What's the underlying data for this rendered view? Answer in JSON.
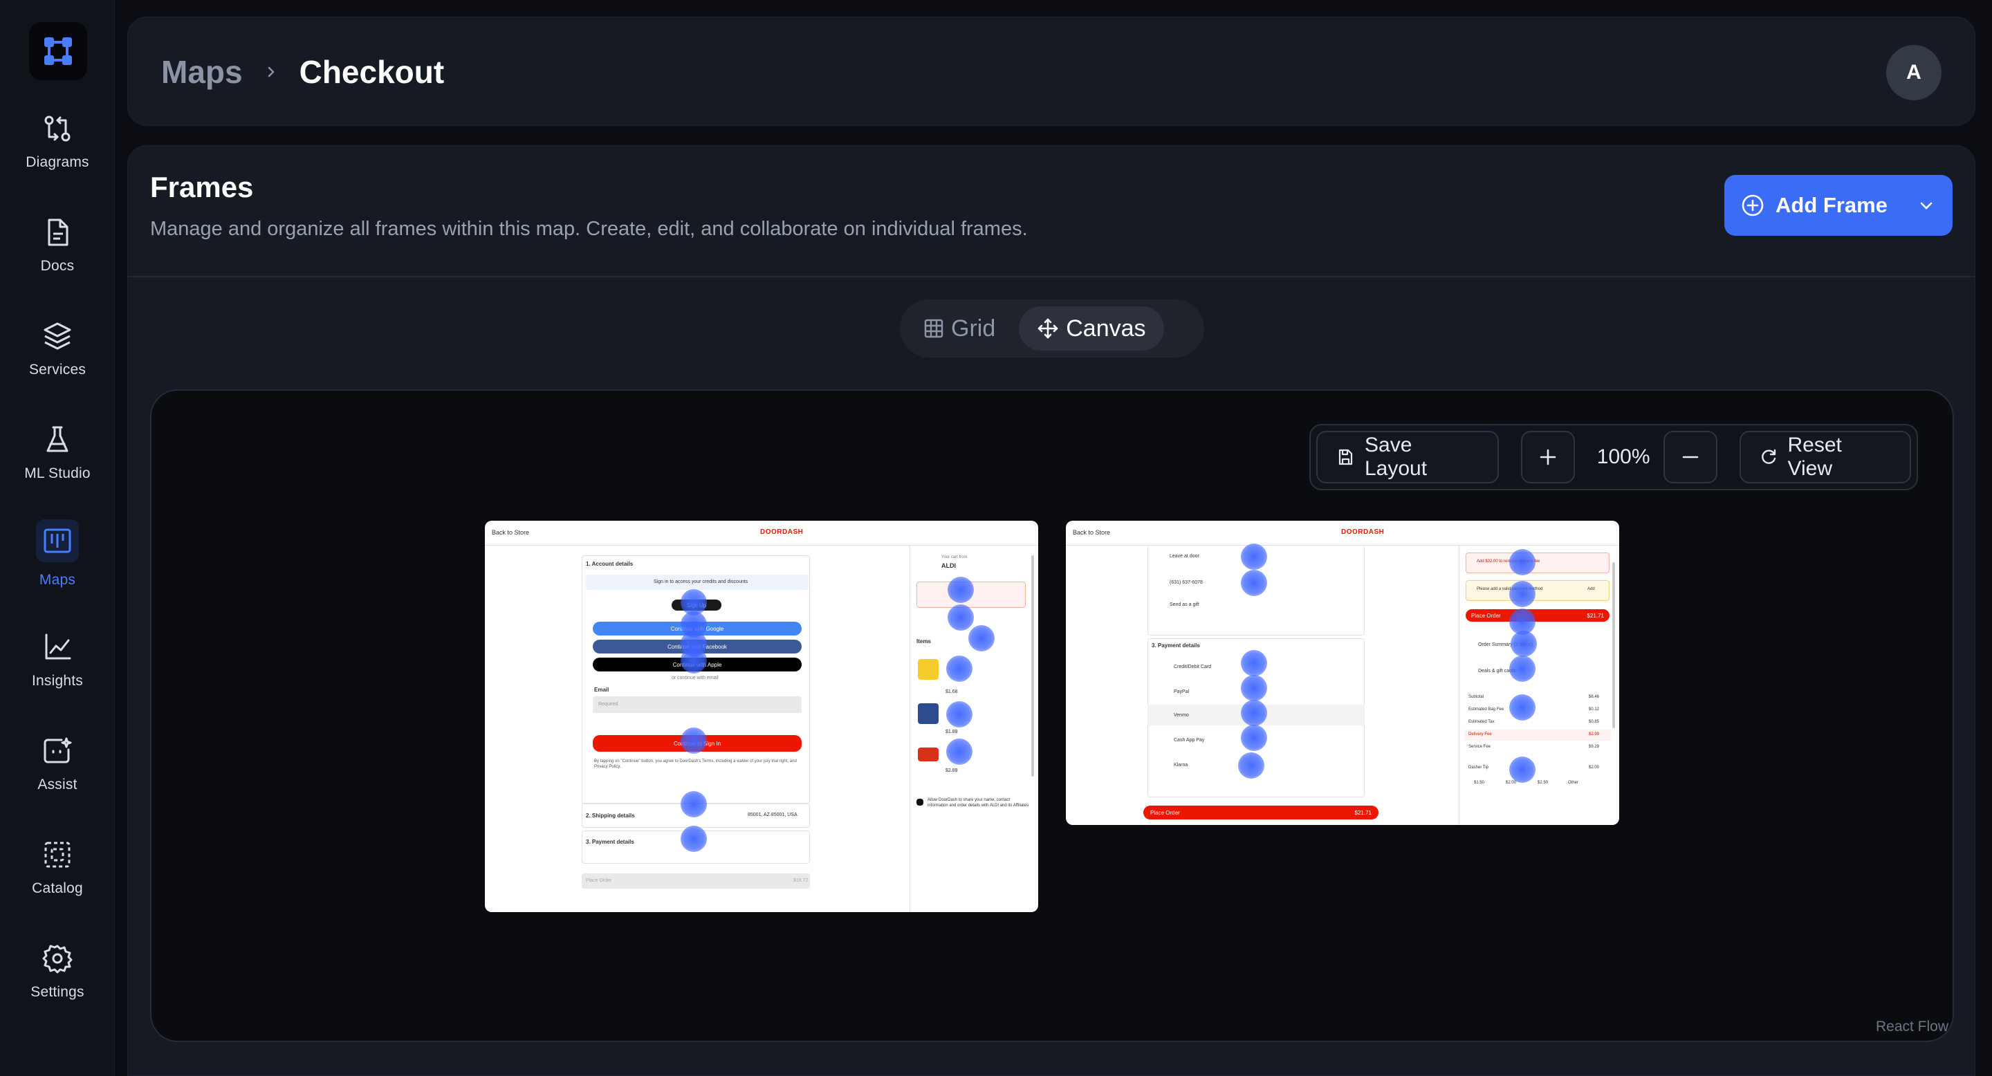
{
  "sidebar": {
    "items": [
      {
        "label": "Diagrams",
        "icon": "diagram-icon"
      },
      {
        "label": "Docs",
        "icon": "doc-icon"
      },
      {
        "label": "Services",
        "icon": "layers-icon"
      },
      {
        "label": "ML Studio",
        "icon": "flask-icon"
      },
      {
        "label": "Maps",
        "icon": "map-icon",
        "active": true
      },
      {
        "label": "Insights",
        "icon": "chart-line-icon"
      },
      {
        "label": "Assist",
        "icon": "assist-icon"
      },
      {
        "label": "Catalog",
        "icon": "catalog-icon"
      },
      {
        "label": "Settings",
        "icon": "gear-icon"
      }
    ]
  },
  "header": {
    "breadcrumb_parent": "Maps",
    "breadcrumb_current": "Checkout",
    "avatar_initial": "A"
  },
  "frames": {
    "title": "Frames",
    "subtitle": "Manage and organize all frames within this map. Create, edit, and collaborate on individual frames.",
    "add_button": "Add Frame"
  },
  "view_toggle": {
    "grid": "Grid",
    "canvas": "Canvas",
    "active": "Canvas"
  },
  "canvas": {
    "save_layout": "Save Layout",
    "zoom": "100%",
    "reset_view": "Reset View",
    "attribution": "React Flow"
  },
  "frame1": {
    "back": "Back to Store",
    "brand": "DOORDASH",
    "account_details": "1. Account details",
    "sign_in_hint": "Sign in to access your credits and discounts",
    "sign_up": "Sign Up",
    "google": "Continue with Google",
    "facebook": "Continue with Facebook",
    "apple": "Continue with Apple",
    "or_email": "or continue with email",
    "email_label": "Email",
    "email_placeholder": "Required",
    "continue": "Continue to Sign In",
    "terms": "By tapping on \"Continue\" button, you agree to DoorDash's Terms, including a waiver of your jury trial right, and Privacy Policy.",
    "shipping": "2. Shipping details",
    "shipping_addr": "85001, AZ 85001, USA",
    "payment": "3. Payment details",
    "place_order": "Place Order",
    "order_total": "$18.72",
    "store_label": "Your cart from",
    "store": "ALDI",
    "items_label": "Items",
    "prices": [
      "$1.68",
      "$1.89",
      "$2.89"
    ],
    "share_info": "Allow DoorDash to share your name, contact information and order details with ALDI and its Affiliates"
  },
  "frame2": {
    "back": "Back to Store",
    "brand": "DOORDASH",
    "leave_at_door": "Leave at door",
    "phone": "(631) 637-6078",
    "send_gift": "Send as a gift",
    "payment": "3. Payment details",
    "methods": [
      "Credit/Debit Card",
      "PayPal",
      "Venmo",
      "Cash App Pay",
      "Klarna"
    ],
    "place_order": "Place Order",
    "order_total": "$21.71",
    "fee_note": "Add $32.00 to remove delivery fee",
    "payment_warning": "Please add a valid payment method",
    "add": "Add",
    "order_summary": "Order Summary (3 items)",
    "deals": "Deals & gift cards",
    "summary": [
      {
        "label": "Subtotal",
        "value": "$6.46"
      },
      {
        "label": "Estimated Bag Fee",
        "value": "$0.12"
      },
      {
        "label": "Estimated Tax",
        "value": "$0.85"
      },
      {
        "label": "Delivery Fee",
        "value": "$2.99"
      },
      {
        "label": "Service Fee",
        "value": "$9.29"
      }
    ],
    "dasher_tip": "Dasher Tip",
    "tip_value": "$2.00",
    "tips": [
      "$1.50",
      "$2.00",
      "$2.50",
      "Other"
    ]
  }
}
